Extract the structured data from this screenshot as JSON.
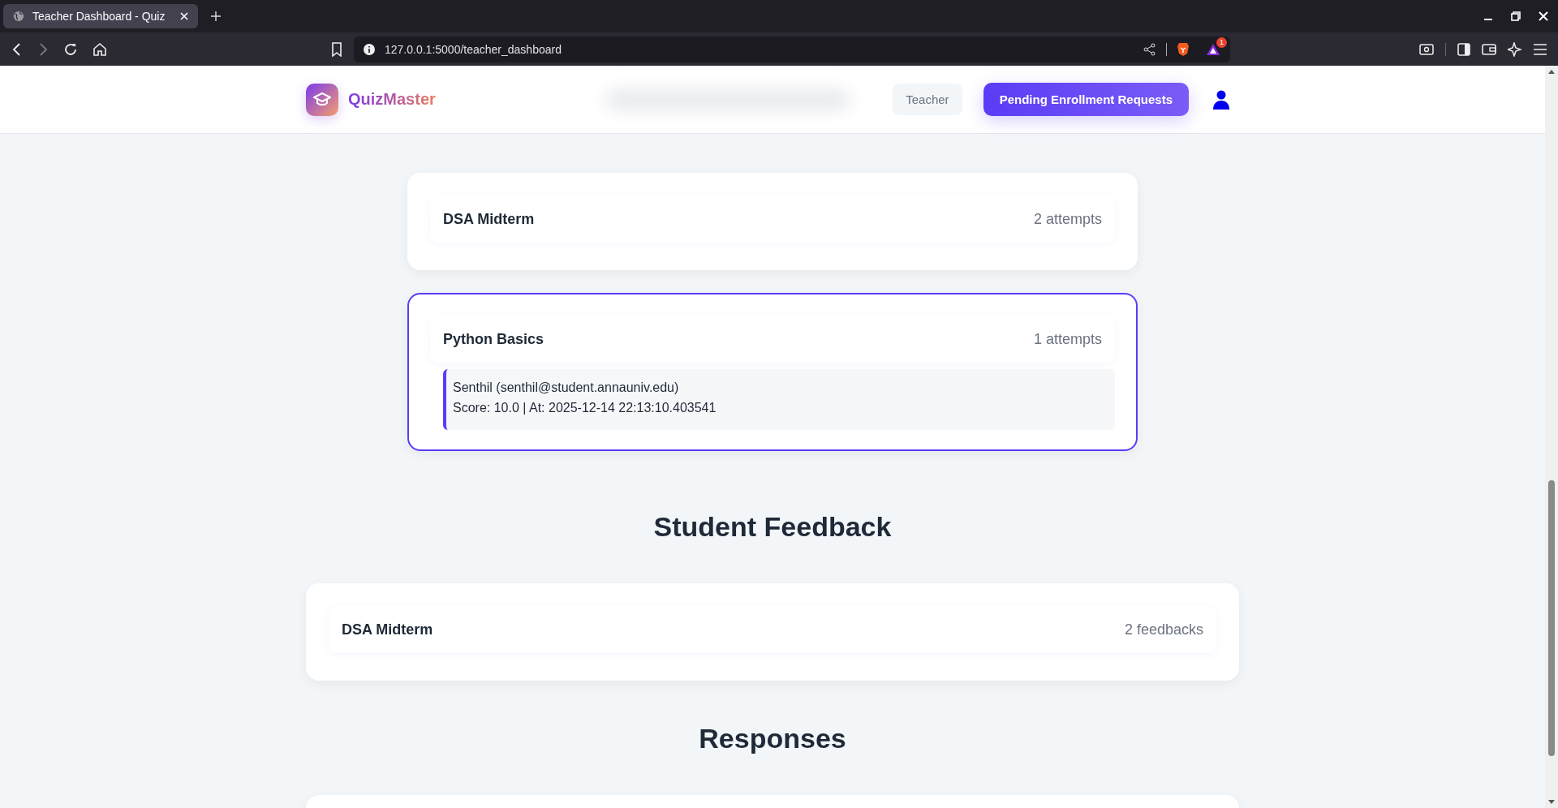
{
  "browser": {
    "tab_title": "Teacher Dashboard - Quiz",
    "url": "127.0.0.1:5000/teacher_dashboard",
    "notification_count": "1"
  },
  "header": {
    "brand": "QuizMaster",
    "role": "Teacher",
    "action_button": "Pending Enrollment Requests"
  },
  "quiz_attempts": [
    {
      "title": "DSA Midterm",
      "count": "2 attempts",
      "expanded": false
    },
    {
      "title": "Python Basics",
      "count": "1 attempts",
      "expanded": true,
      "attempts": [
        {
          "student": "Senthil (senthil@student.annauniv.edu)",
          "detail": "Score: 10.0 | At: 2025-12-14 22:13:10.403541"
        }
      ]
    }
  ],
  "feedback_section": {
    "heading": "Student Feedback",
    "items": [
      {
        "title": "DSA Midterm",
        "count": "2 feedbacks"
      }
    ]
  },
  "responses_section": {
    "heading": "Responses"
  }
}
